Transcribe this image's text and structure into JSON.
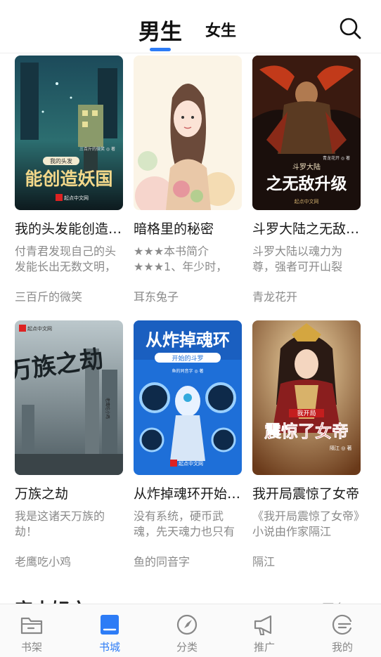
{
  "header": {
    "tabs": [
      {
        "label": "男生",
        "active": true
      },
      {
        "label": "女生",
        "active": false
      }
    ],
    "search_icon": "search-icon",
    "accent_color": "#2d7cf6"
  },
  "books": [
    {
      "title": "我的头发能创造妖国",
      "desc": "付青君发现自己的头发能长出无数文明，",
      "author": "三百斤的微笑",
      "cover_text": [
        "我的头发",
        "能创造妖国"
      ],
      "cover_small": "三百斤的微笑 ◎ 著"
    },
    {
      "title": "暗格里的秘密",
      "desc": "★★★本书简介★★★1、年少时，",
      "author": "耳东兔子"
    },
    {
      "title": "斗罗大陆之无敌升级",
      "desc": "斗罗大陆以魂力为尊，强者可开山裂石，",
      "author": "青龙花开",
      "cover_text": [
        "斗罗大陆",
        "之无敌升级"
      ],
      "cover_small": "青龙花开 ◎ 著"
    },
    {
      "title": "万族之劫",
      "desc": "我是这诸天万族的劫！",
      "author": "老鹰吃小鸡",
      "cover_text": [
        "万族之劫"
      ],
      "cover_small": "老鹰吃小鸡"
    },
    {
      "title": "从炸掉魂环开始斗罗",
      "desc": "没有系统，硬币武魂，先天魂力也只有",
      "author": "鱼的同音字",
      "cover_text": [
        "从炸掉魂环",
        "开始的斗罗"
      ],
      "cover_small": "鱼的同音字 ◎ 著"
    },
    {
      "title": "我开局震惊了女帝",
      "desc": "《我开局震惊了女帝》小说由作家隔江",
      "author": "隔江",
      "cover_text": [
        "我开局",
        "震惊了女帝"
      ],
      "cover_small": "隔江 ◎ 著"
    }
  ],
  "cover_badge": "起点中文网",
  "section": {
    "title": "完本好文",
    "more": "更多 >"
  },
  "bottom_nav": [
    {
      "label": "书架",
      "icon": "folder-icon",
      "active": false
    },
    {
      "label": "书城",
      "icon": "bookstore-icon",
      "active": true
    },
    {
      "label": "分类",
      "icon": "compass-icon",
      "active": false
    },
    {
      "label": "推广",
      "icon": "megaphone-icon",
      "active": false
    },
    {
      "label": "我的",
      "icon": "profile-icon",
      "active": false
    }
  ]
}
